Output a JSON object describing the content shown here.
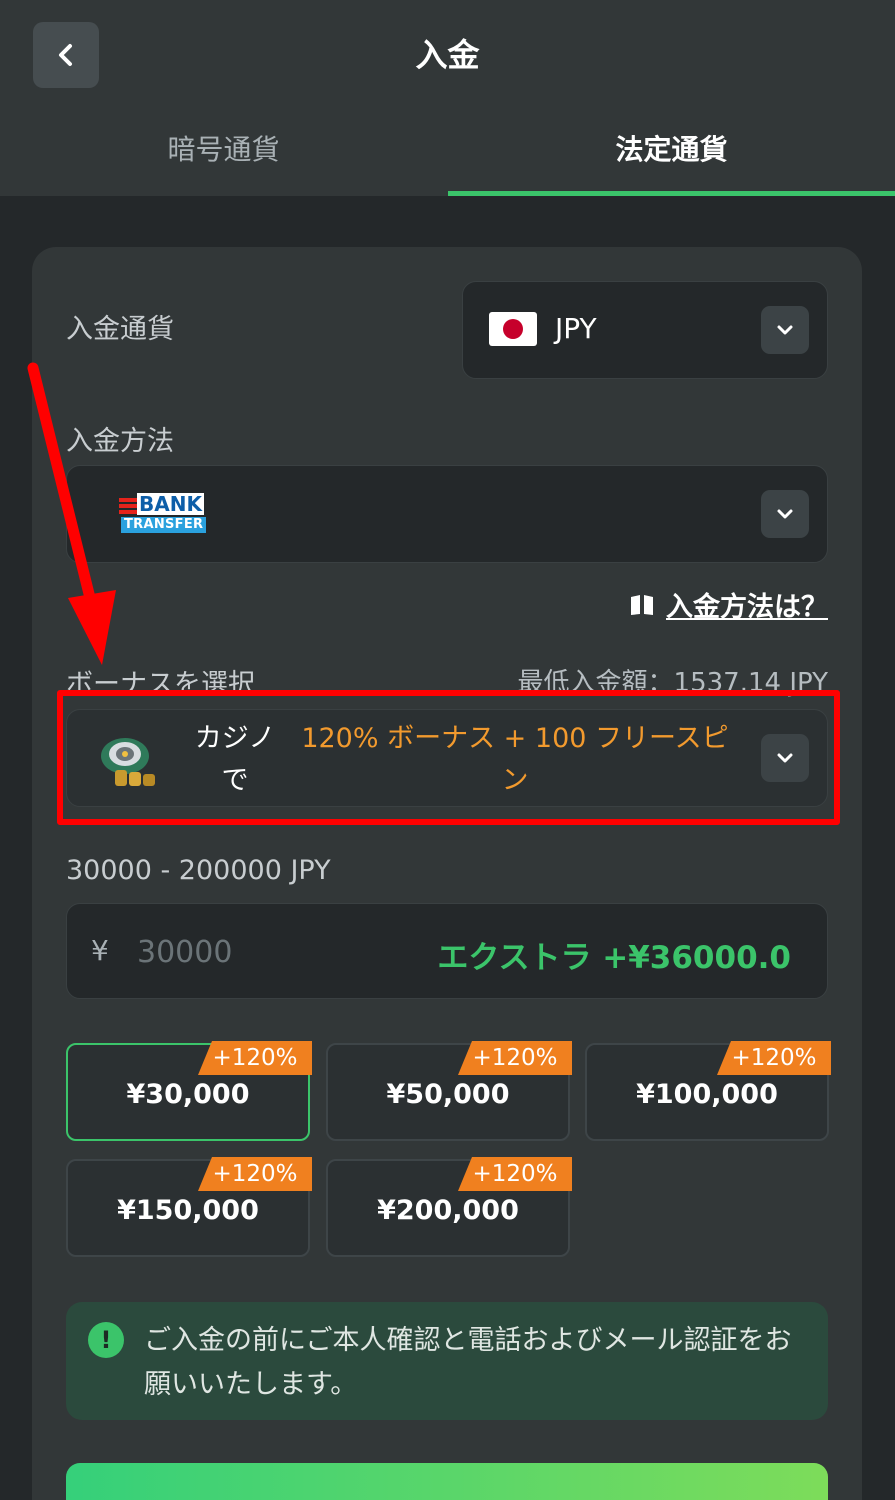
{
  "header": {
    "title": "入金",
    "back_icon": "chevron-left-icon"
  },
  "tabs": [
    {
      "label": "暗号通貨",
      "active": false
    },
    {
      "label": "法定通貨",
      "active": true
    }
  ],
  "colors": {
    "accent_green": "#3bc46a",
    "bonus_orange": "#f29a2e",
    "annotation_red": "#ff0000"
  },
  "deposit_currency": {
    "label": "入金通貨",
    "value": "JPY",
    "flag_icon": "japan-flag-icon"
  },
  "deposit_method": {
    "label": "入金方法",
    "logo_word": "BANK",
    "logo_sub": "TRANSFER",
    "help_link": "入金方法は？",
    "help_icon": "book-icon"
  },
  "bonus": {
    "label": "ボーナスを選択",
    "min_deposit": "最低入金額：1537.14 JPY",
    "where": "カジノで",
    "offer": "120% ボーナス + 100 フリースピン",
    "icon": "roulette-chips-icon"
  },
  "amount": {
    "range": "30000 - 200000 JPY",
    "currency_symbol": "¥",
    "placeholder": "30000",
    "extra": "エクストラ +¥36000.0"
  },
  "presets": [
    {
      "amount": "¥30,000",
      "badge": "+120%",
      "selected": true
    },
    {
      "amount": "¥50,000",
      "badge": "+120%",
      "selected": false
    },
    {
      "amount": "¥100,000",
      "badge": "+120%",
      "selected": false
    },
    {
      "amount": "¥150,000",
      "badge": "+120%",
      "selected": false
    },
    {
      "amount": "¥200,000",
      "badge": "+120%",
      "selected": false
    }
  ],
  "notice": {
    "icon": "exclamation-icon",
    "text": "ご入金の前にご本人確認と電話およびメール認証をお願いいたします。"
  },
  "submit": {
    "label": ""
  }
}
